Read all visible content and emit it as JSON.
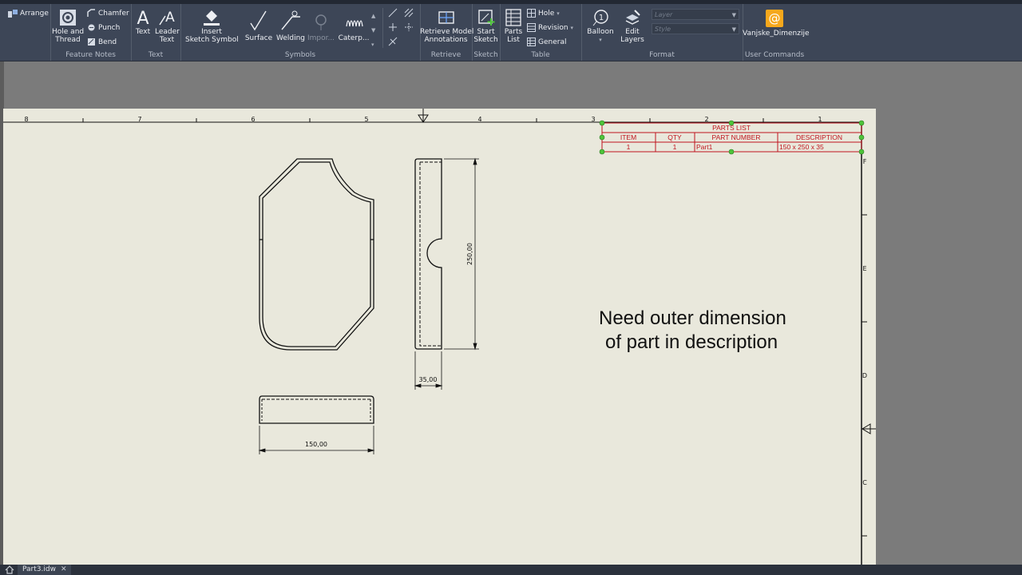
{
  "ribbon": {
    "groups": {
      "feature_notes": "Feature Notes",
      "text": "Text",
      "symbols": "Symbols",
      "retrieve": "Retrieve",
      "sketch": "Sketch",
      "table": "Table",
      "format": "Format",
      "user_commands": "User Commands"
    },
    "buttons": {
      "arrange": "Arrange",
      "hole_thread_1": "Hole and",
      "hole_thread_2": "Thread",
      "chamfer": "Chamfer",
      "punch": "Punch",
      "bend": "Bend",
      "text": "Text",
      "leader_text_1": "Leader",
      "leader_text_2": "Text",
      "insert_sketch_1": "Insert",
      "insert_sketch_2": "Sketch Symbol",
      "surface": "Surface",
      "welding": "Welding",
      "import": "Impor...",
      "caterpillar": "Caterp...",
      "retrieve_1": "Retrieve Model",
      "retrieve_2": "Annotations",
      "start_sketch_1": "Start",
      "start_sketch_2": "Sketch",
      "parts_list_1": "Parts",
      "parts_list_2": "List",
      "hole": "Hole",
      "revision": "Revision",
      "general": "General",
      "balloon": "Balloon",
      "edit_layers_1": "Edit",
      "edit_layers_2": "Layers",
      "vanjske": "Vanjske_Dimenzije"
    },
    "combos": {
      "layer": "Layer",
      "style": "Style"
    }
  },
  "drawing": {
    "ruler_numbers": [
      "8",
      "7",
      "6",
      "5",
      "4",
      "3",
      "2",
      "1"
    ],
    "zone_letters": [
      "F",
      "E",
      "D",
      "C"
    ],
    "dimensions": {
      "height": "250,00",
      "thickness": "35,00",
      "width": "150,00"
    },
    "parts_list": {
      "title": "PARTS LIST",
      "headers": [
        "ITEM",
        "QTY",
        "PART NUMBER",
        "DESCRIPTION"
      ],
      "rows": [
        [
          "1",
          "1",
          "Part1",
          "150 x 250 x 35"
        ]
      ]
    },
    "note": {
      "line1": "Need outer dimension",
      "line2": "of part in description"
    }
  },
  "status": {
    "doc_tab": "Part3.idw"
  },
  "colors": {
    "ribbon_bg": "#3d4657",
    "sheet_bg": "#e9e8dc",
    "table_red": "#c0141e",
    "grip_green": "#4ec43a"
  }
}
